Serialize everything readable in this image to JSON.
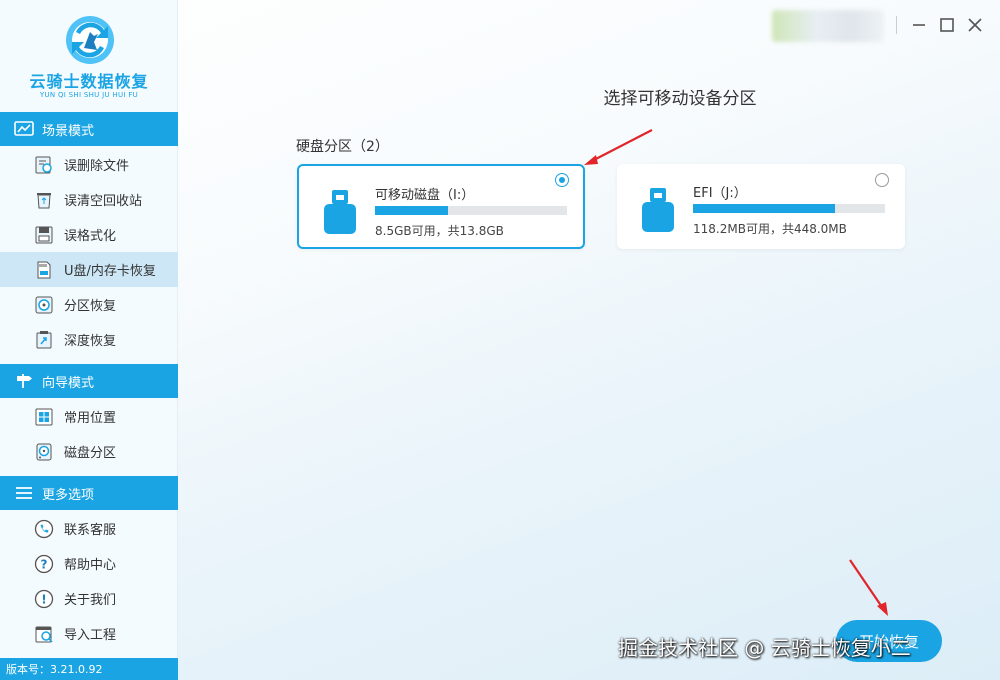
{
  "app": {
    "logo_title": "云骑士数据恢复",
    "logo_subtitle": "YUN QI SHI SHU JU HUI FU",
    "version": "版本号：3.21.0.92",
    "accent_color": "#1ba4e3"
  },
  "sidebar": {
    "sections": [
      {
        "title": "场景模式",
        "icon": "scene-icon"
      },
      {
        "title": "向导模式",
        "icon": "signpost-icon"
      },
      {
        "title": "更多选项",
        "icon": "menu-icon"
      }
    ],
    "items": [
      {
        "label": "误删除文件",
        "icon": "deleted-file-icon"
      },
      {
        "label": "误清空回收站",
        "icon": "recycle-bin-icon"
      },
      {
        "label": "误格式化",
        "icon": "format-icon"
      },
      {
        "label": "U盘/内存卡恢复",
        "icon": "sd-card-icon",
        "active": true
      },
      {
        "label": "分区恢复",
        "icon": "partition-icon"
      },
      {
        "label": "深度恢复",
        "icon": "deep-recovery-icon"
      },
      {
        "label": "常用位置",
        "icon": "windows-icon"
      },
      {
        "label": "磁盘分区",
        "icon": "disk-icon"
      },
      {
        "label": "联系客服",
        "icon": "phone-icon"
      },
      {
        "label": "帮助中心",
        "icon": "help-icon"
      },
      {
        "label": "关于我们",
        "icon": "info-icon"
      },
      {
        "label": "导入工程",
        "icon": "import-icon"
      }
    ]
  },
  "window_controls": [
    "minimize-icon",
    "maximize-icon",
    "close-icon"
  ],
  "main": {
    "title": "选择可移动设备分区",
    "group_label": "硬盘分区（2）",
    "partitions": [
      {
        "name": "可移动磁盘（I:）",
        "size_text": "8.5GB可用，共13.8GB",
        "used_fraction": 0.38,
        "selected": true
      },
      {
        "name": "EFI（J:）",
        "size_text": "118.2MB可用，共448.0MB",
        "used_fraction": 0.74,
        "selected": false
      }
    ],
    "start_button": "开始恢复"
  },
  "watermark": "掘金技术社区 @ 云骑士恢复小二"
}
